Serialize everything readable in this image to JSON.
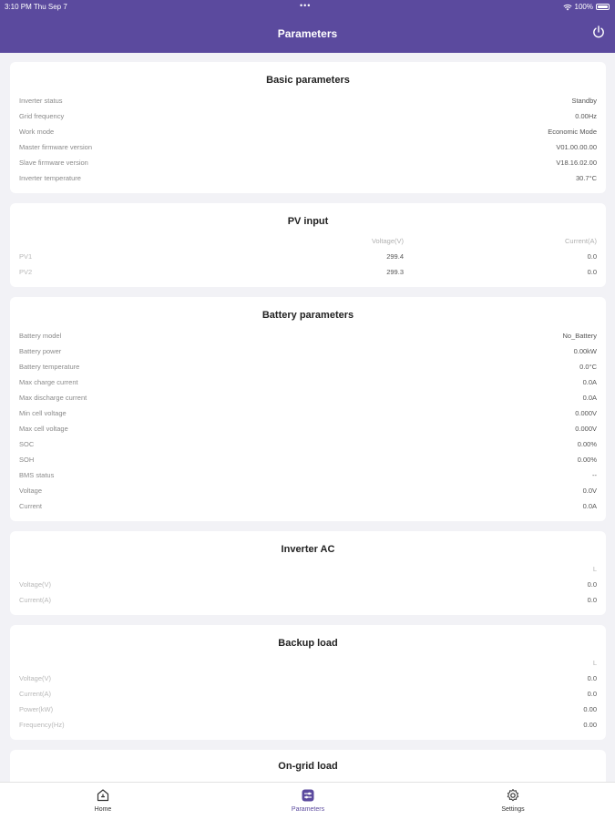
{
  "status_bar": {
    "time": "3:10 PM   Thu Sep 7",
    "dots": "•••",
    "battery_text": "100%"
  },
  "header": {
    "title": "Parameters"
  },
  "basic": {
    "title": "Basic parameters",
    "rows": [
      {
        "label": "Inverter status",
        "value": "Standby"
      },
      {
        "label": "Grid frequency",
        "value": "0.00Hz"
      },
      {
        "label": "Work mode",
        "value": "Economic Mode"
      },
      {
        "label": "Master firmware version",
        "value": "V01.00.00.00"
      },
      {
        "label": "Slave firmware version",
        "value": "V18.16.02.00"
      },
      {
        "label": "Inverter temperature",
        "value": "30.7°C"
      }
    ]
  },
  "pv": {
    "title": "PV input",
    "col1": "Voltage(V)",
    "col2": "Current(A)",
    "rows": [
      {
        "label": "PV1",
        "voltage": "299.4",
        "current": "0.0"
      },
      {
        "label": "PV2",
        "voltage": "299.3",
        "current": "0.0"
      }
    ]
  },
  "battery": {
    "title": "Battery parameters",
    "rows": [
      {
        "label": "Battery model",
        "value": "No_Battery"
      },
      {
        "label": "Battery power",
        "value": "0.00kW"
      },
      {
        "label": "Battery temperature",
        "value": "0.0°C"
      },
      {
        "label": "Max charge current",
        "value": "0.0A"
      },
      {
        "label": "Max discharge current",
        "value": "0.0A"
      },
      {
        "label": "Min cell voltage",
        "value": "0.000V"
      },
      {
        "label": "Max cell voltage",
        "value": "0.000V"
      },
      {
        "label": "SOC",
        "value": "0.00%"
      },
      {
        "label": "SOH",
        "value": "0.00%"
      },
      {
        "label": "BMS status",
        "value": "--"
      },
      {
        "label": "Voltage",
        "value": "0.0V"
      },
      {
        "label": "Current",
        "value": "0.0A"
      }
    ]
  },
  "inverter_ac": {
    "title": "Inverter AC",
    "col": "L",
    "rows": [
      {
        "label": "Voltage(V)",
        "value": "0.0"
      },
      {
        "label": "Current(A)",
        "value": "0.0"
      }
    ]
  },
  "backup": {
    "title": "Backup load",
    "col": "L",
    "rows": [
      {
        "label": "Voltage(V)",
        "value": "0.0"
      },
      {
        "label": "Current(A)",
        "value": "0.0"
      },
      {
        "label": "Power(kW)",
        "value": "0.00"
      },
      {
        "label": "Frequency(Hz)",
        "value": "0.00"
      }
    ]
  },
  "ongrid": {
    "title": "On-grid load"
  },
  "tabs": {
    "home": "Home",
    "parameters": "Parameters",
    "settings": "Settings"
  },
  "colors": {
    "accent": "#5b4a9e",
    "background": "#f2f2f6"
  }
}
